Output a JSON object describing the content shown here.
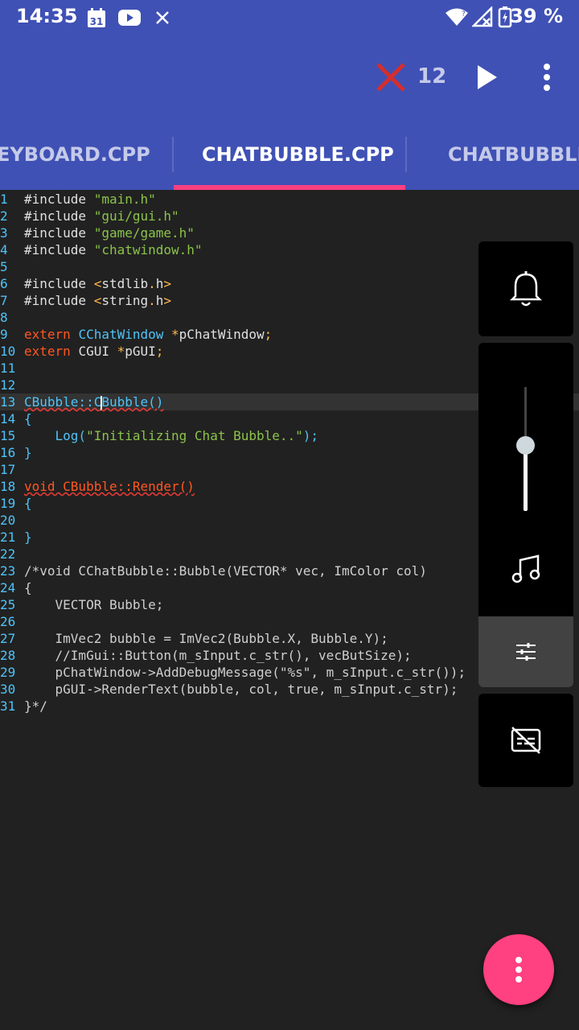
{
  "status_bar": {
    "time": "14:35",
    "calendar_day": "31",
    "battery": "39 %"
  },
  "toolbar": {
    "error_count": "12",
    "icons": [
      "error-x-icon",
      "play-icon",
      "more-vert-icon"
    ]
  },
  "tabs": [
    {
      "label": "EYBOARD.CPP",
      "active": false
    },
    {
      "label": "CHATBUBBLE.CPP",
      "active": true
    },
    {
      "label": "CHATBUBBLE.H",
      "active": false
    }
  ],
  "colors": {
    "primary": "#3f51b5",
    "accent": "#ff4081",
    "editor_bg": "#212121",
    "line_number": "#4fc3f7"
  },
  "editor": {
    "lines": [
      {
        "n": "1",
        "tokens": [
          {
            "t": "#include ",
            "c": "d"
          },
          {
            "t": "\"main.h\"",
            "c": "s"
          }
        ]
      },
      {
        "n": "2",
        "tokens": [
          {
            "t": "#include ",
            "c": "d"
          },
          {
            "t": "\"gui/gui.h\"",
            "c": "s"
          }
        ]
      },
      {
        "n": "3",
        "tokens": [
          {
            "t": "#include ",
            "c": "d"
          },
          {
            "t": "\"game/game.h\"",
            "c": "s"
          }
        ]
      },
      {
        "n": "4",
        "tokens": [
          {
            "t": "#include ",
            "c": "d"
          },
          {
            "t": "\"chatwindow.h\"",
            "c": "s"
          }
        ]
      },
      {
        "n": "5",
        "tokens": []
      },
      {
        "n": "6",
        "tokens": [
          {
            "t": "#include ",
            "c": "d"
          },
          {
            "t": "<",
            "c": "p"
          },
          {
            "t": "stdlib",
            "c": "d"
          },
          {
            "t": ".",
            "c": "p"
          },
          {
            "t": "h",
            "c": "d"
          },
          {
            "t": ">",
            "c": "p"
          }
        ]
      },
      {
        "n": "7",
        "tokens": [
          {
            "t": "#include ",
            "c": "d"
          },
          {
            "t": "<",
            "c": "p"
          },
          {
            "t": "string",
            "c": "d"
          },
          {
            "t": ".",
            "c": "p"
          },
          {
            "t": "h",
            "c": "d"
          },
          {
            "t": ">",
            "c": "p"
          }
        ]
      },
      {
        "n": "8",
        "tokens": []
      },
      {
        "n": "9",
        "tokens": [
          {
            "t": "extern ",
            "c": "k"
          },
          {
            "t": "CChatWindow ",
            "c": "c"
          },
          {
            "t": "*",
            "c": "p"
          },
          {
            "t": "pChatWindow",
            "c": "d"
          },
          {
            "t": ";",
            "c": "p"
          }
        ]
      },
      {
        "n": "10",
        "tokens": [
          {
            "t": "extern ",
            "c": "k"
          },
          {
            "t": "CGUI ",
            "c": "d"
          },
          {
            "t": "*",
            "c": "p"
          },
          {
            "t": "pGUI",
            "c": "d"
          },
          {
            "t": ";",
            "c": "p"
          }
        ]
      },
      {
        "n": "11",
        "tokens": []
      },
      {
        "n": "12",
        "tokens": []
      },
      {
        "n": "13",
        "hl": true,
        "tokens": [
          {
            "t": "CBubble::C",
            "c": "c",
            "sq": true
          },
          {
            "caret": true
          },
          {
            "t": "Bubble()",
            "c": "c",
            "sq": true
          }
        ]
      },
      {
        "n": "14",
        "tokens": [
          {
            "t": "{",
            "c": "c"
          }
        ]
      },
      {
        "n": "15",
        "tokens": [
          {
            "t": "    Log(",
            "c": "c"
          },
          {
            "t": "\"Initializing Chat Bubble..\"",
            "c": "s"
          },
          {
            "t": ");",
            "c": "c"
          }
        ]
      },
      {
        "n": "16",
        "tokens": [
          {
            "t": "}",
            "c": "c"
          }
        ]
      },
      {
        "n": "17",
        "tokens": []
      },
      {
        "n": "18",
        "tokens": [
          {
            "t": "void CBubble::Render()",
            "c": "k",
            "sq": true
          }
        ]
      },
      {
        "n": "19",
        "tokens": [
          {
            "t": "{",
            "c": "c"
          }
        ]
      },
      {
        "n": "20",
        "tokens": []
      },
      {
        "n": "21",
        "tokens": [
          {
            "t": "}",
            "c": "c"
          }
        ]
      },
      {
        "n": "22",
        "tokens": []
      },
      {
        "n": "23",
        "tokens": [
          {
            "t": "/*void CChatBubble::Bubble(VECTOR* vec, ImColor col)",
            "c": "m"
          }
        ]
      },
      {
        "n": "24",
        "tokens": [
          {
            "t": "{",
            "c": "m"
          }
        ]
      },
      {
        "n": "25",
        "tokens": [
          {
            "t": "    VECTOR Bubble;",
            "c": "m"
          }
        ]
      },
      {
        "n": "26",
        "tokens": []
      },
      {
        "n": "27",
        "tokens": [
          {
            "t": "    ImVec2 bubble = ImVec2(Bubble.X, Bubble.Y);",
            "c": "m"
          }
        ]
      },
      {
        "n": "28",
        "tokens": [
          {
            "t": "    //ImGui::Button(m_sInput.c_str(), vecButSize);",
            "c": "m"
          }
        ]
      },
      {
        "n": "29",
        "tokens": [
          {
            "t": "    pChatWindow->AddDebugMessage(\"%s\", m_sInput.c_str());",
            "c": "m"
          }
        ]
      },
      {
        "n": "30",
        "tokens": [
          {
            "t": "    pGUI->RenderText(bubble, col, true, m_sInput.c_str);",
            "c": "m"
          }
        ]
      },
      {
        "n": "31",
        "tokens": [
          {
            "t": "}*/",
            "c": "m"
          }
        ]
      }
    ]
  },
  "volume_panel": {
    "media_level": 0.5,
    "icons": [
      "bell-icon",
      "music-note-icon",
      "tune-icon",
      "captions-off-icon"
    ]
  },
  "fab": {
    "icon": "more-vert-icon"
  }
}
